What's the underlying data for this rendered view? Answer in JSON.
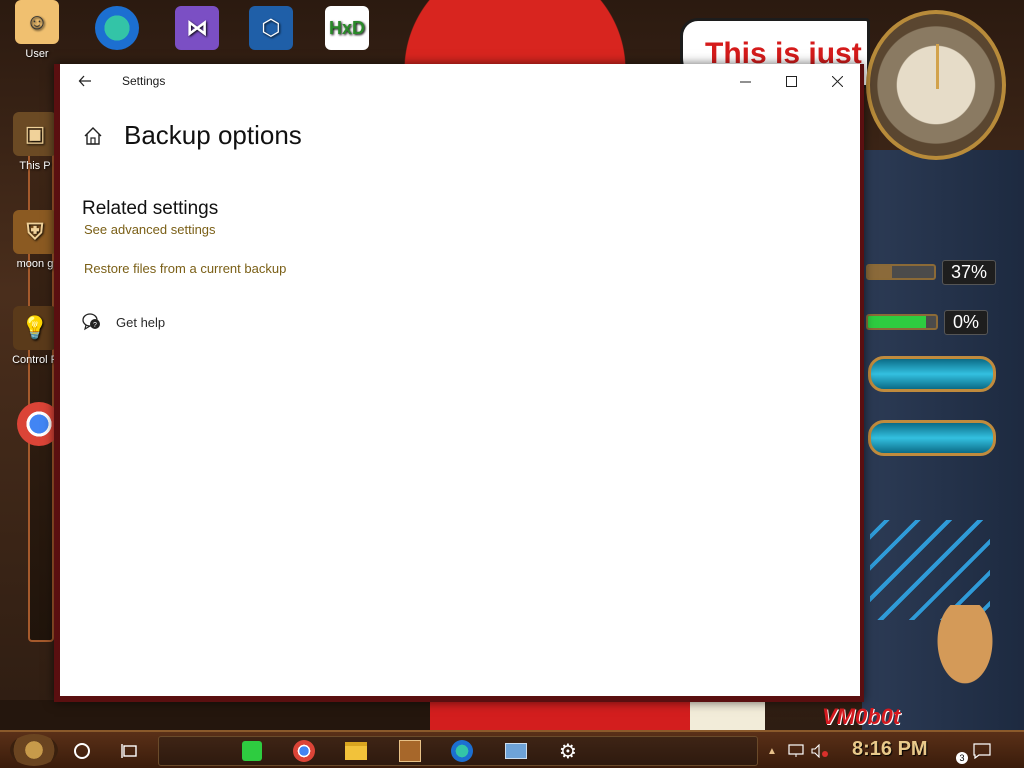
{
  "desktop": {
    "banner_text": "This is just",
    "vm_label": "VM0b0t",
    "icons": [
      {
        "label": "User",
        "name": "user-folder"
      },
      {
        "label": "This P",
        "name": "this-pc"
      },
      {
        "label": "moon g",
        "name": "moon-game"
      },
      {
        "label": "Control P",
        "name": "control-panel"
      }
    ],
    "gauges": [
      {
        "value": "37%",
        "fill": 0.37,
        "color": "#8b6a3a"
      },
      {
        "value": "0%",
        "fill": 0.85,
        "color": "#2ecc40"
      }
    ]
  },
  "window": {
    "title": "Settings",
    "page_title": "Backup options",
    "related_heading": "Related settings",
    "advanced_link": "See advanced settings",
    "restore_link": "Restore files from a current backup",
    "help_label": "Get help"
  },
  "taskbar": {
    "time": "8:16 PM",
    "notification_count": "3"
  },
  "colors": {
    "link": "#7a5f16",
    "window_border": "#5a0f10",
    "taskbar": "#3a1c0b"
  }
}
